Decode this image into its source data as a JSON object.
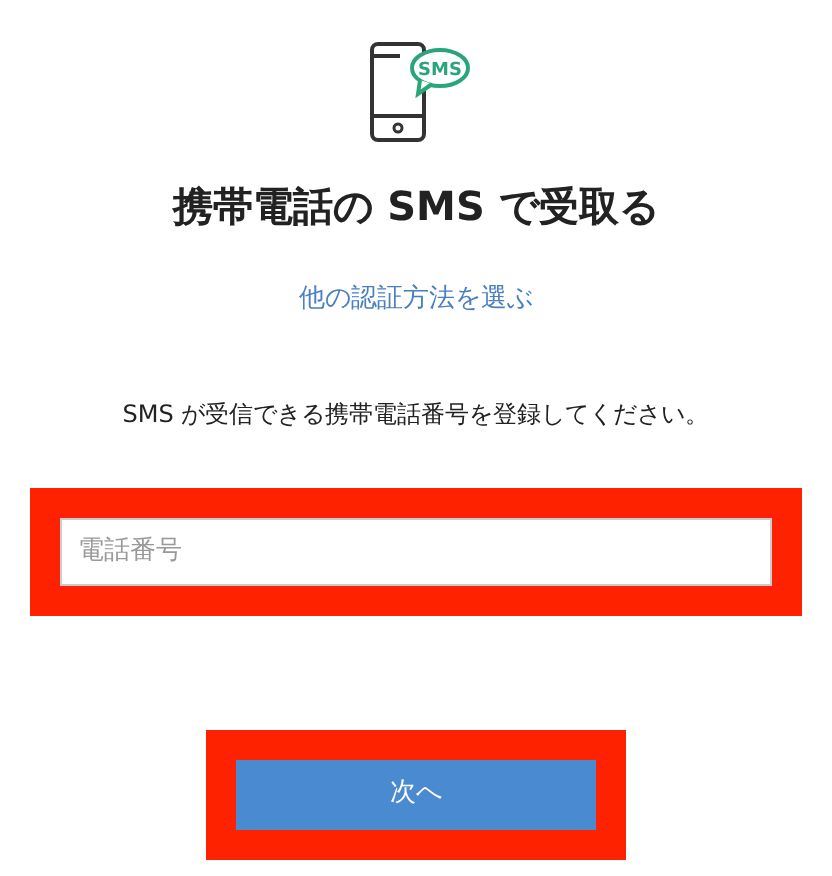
{
  "icon_badge": "SMS",
  "title": "携帯電話の SMS で受取る",
  "alt_link": "他の認証方法を選ぶ",
  "instruction": "SMS が受信できる携帯電話番号を登録してください。",
  "phone_field": {
    "placeholder": "電話番号",
    "highlighted": true
  },
  "next_button": {
    "label": "次へ",
    "highlighted": true
  }
}
